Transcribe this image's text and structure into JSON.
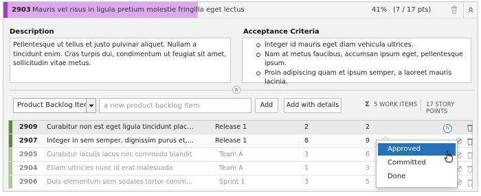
{
  "header": {
    "id": "2903",
    "title": "Mauris vel risus in ligula pretium molestie fringilla eget lectus",
    "progress_percent": 41,
    "progress_text": "41%",
    "points_text": "(7 / 17 pts)",
    "accent_color": "#a23cc0",
    "progress_color": "#dca8ee"
  },
  "description": {
    "label": "Description",
    "text": "Pellentesque ut tellus et justo pulvinar aliquet. Nullam a tincidunt enim. Cras turpis dui, condimentum ut feugiat sit amet, sollicitudin vitae metus."
  },
  "acceptance": {
    "label": "Acceptance Criteria",
    "items": [
      "Integer id mauris eget diam vehicula ultrices.",
      "Nam at metus faucibus, accumsan ipsum eget, pellentesque ipsum.",
      "Proin adipiscing quam et ipsum semper, a laoreet mauris lacinia."
    ]
  },
  "add_bar": {
    "type_selected": "Product Backlog Item",
    "input_placeholder": "a new product backlog item",
    "add_label": "Add",
    "add_details_label": "Add with details",
    "sigma": "Σ",
    "work_items": "5 WORK ITEMS",
    "story_points": "17 STORY POINTS"
  },
  "rows": [
    {
      "id": "2909",
      "title": "Curabitur non est eget ligula tincidunt placerat",
      "iteration": "Release 1",
      "c1": "2",
      "c2": "2",
      "color": "#5a8f2a",
      "dim": false
    },
    {
      "id": "2907",
      "title": "Integer in sem semper, dignissim purus et, interdum erat",
      "iteration": "Release 1",
      "c1": "8",
      "c2": "9",
      "color": "#5a8f2a",
      "dim": false
    },
    {
      "id": "2905",
      "title": "Curabitur iaculis lacus nec commodo blandit",
      "iteration": "Team A",
      "c1": "3",
      "c2": "6",
      "color": "#a9cf7e",
      "dim": true
    },
    {
      "id": "2904",
      "title": "Etiam ultricies nunc id erat malesuada",
      "iteration": "Team A",
      "c1": "1",
      "c2": "3",
      "color": "#a9cf7e",
      "dim": true
    },
    {
      "id": "2906",
      "title": "Duis elementum sem sodales tortor commodo molestie",
      "iteration": "Sprint 1",
      "c1": "3",
      "c2": "5",
      "color": "#a9cf7e",
      "dim": true
    }
  ],
  "status_menu": {
    "badge": "N",
    "options": [
      "Approved",
      "Committed",
      "Done"
    ],
    "selected": "Approved",
    "highlight_color": "#2572b8"
  }
}
